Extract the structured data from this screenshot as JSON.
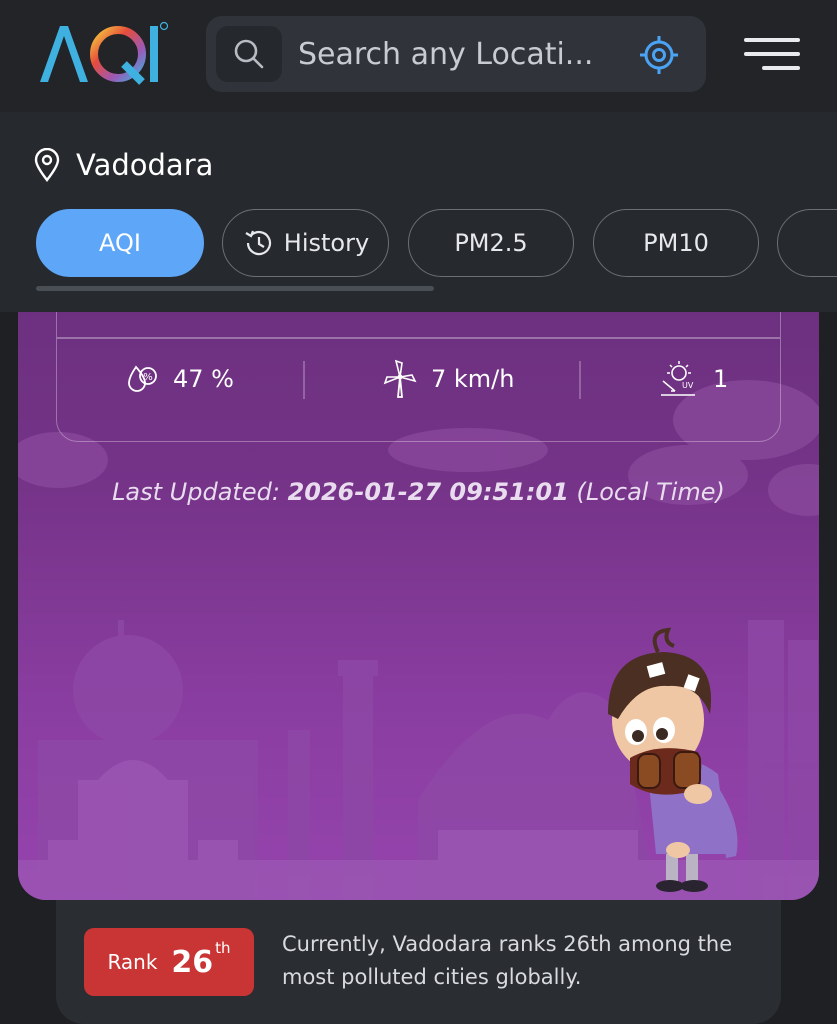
{
  "app": {
    "logo_text": "AQI"
  },
  "search": {
    "placeholder": "Search any Locati..."
  },
  "location": {
    "name": "Vadodara"
  },
  "tabs": [
    {
      "label": "AQI",
      "active": true
    },
    {
      "label": "History",
      "icon": "history-icon"
    },
    {
      "label": "PM2.5"
    },
    {
      "label": "PM10"
    }
  ],
  "weather": {
    "humidity": "47 %",
    "wind": "7 km/h",
    "uv": "1"
  },
  "last_updated": {
    "prefix": "Last Updated:",
    "timestamp": "2026-01-27 09:51:01",
    "suffix": "(Local Time)"
  },
  "rank": {
    "label": "Rank",
    "number": "26",
    "suffix": "th",
    "description": "Currently, Vadodara ranks 26th among the most polluted cities globally."
  },
  "colors": {
    "accent": "#5ea6f8",
    "card_purple": "#7a358c",
    "rank_red": "#c93434"
  }
}
